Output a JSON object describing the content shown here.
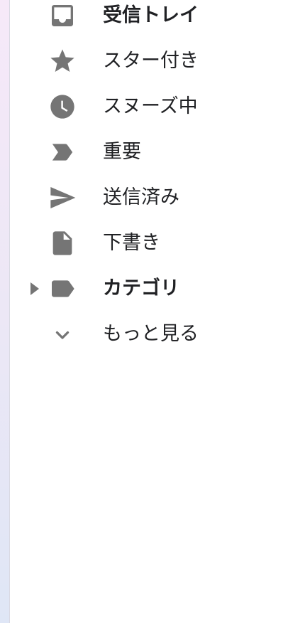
{
  "nav": {
    "items": [
      {
        "label": "受信トレイ",
        "icon": "inbox-icon",
        "bold": true
      },
      {
        "label": "スター付き",
        "icon": "star-icon",
        "bold": false
      },
      {
        "label": "スヌーズ中",
        "icon": "clock-icon",
        "bold": false
      },
      {
        "label": "重要",
        "icon": "label-important-icon",
        "bold": false
      },
      {
        "label": "送信済み",
        "icon": "send-icon",
        "bold": false
      },
      {
        "label": "下書き",
        "icon": "file-icon",
        "bold": false
      },
      {
        "label": "カテゴリ",
        "icon": "label-icon",
        "bold": true,
        "expand_icon": "caret-right-icon"
      },
      {
        "label": "もっと見る",
        "icon": "chevron-down-icon",
        "bold": false
      }
    ]
  },
  "colors": {
    "icon": "#757575",
    "text": "#202124"
  }
}
